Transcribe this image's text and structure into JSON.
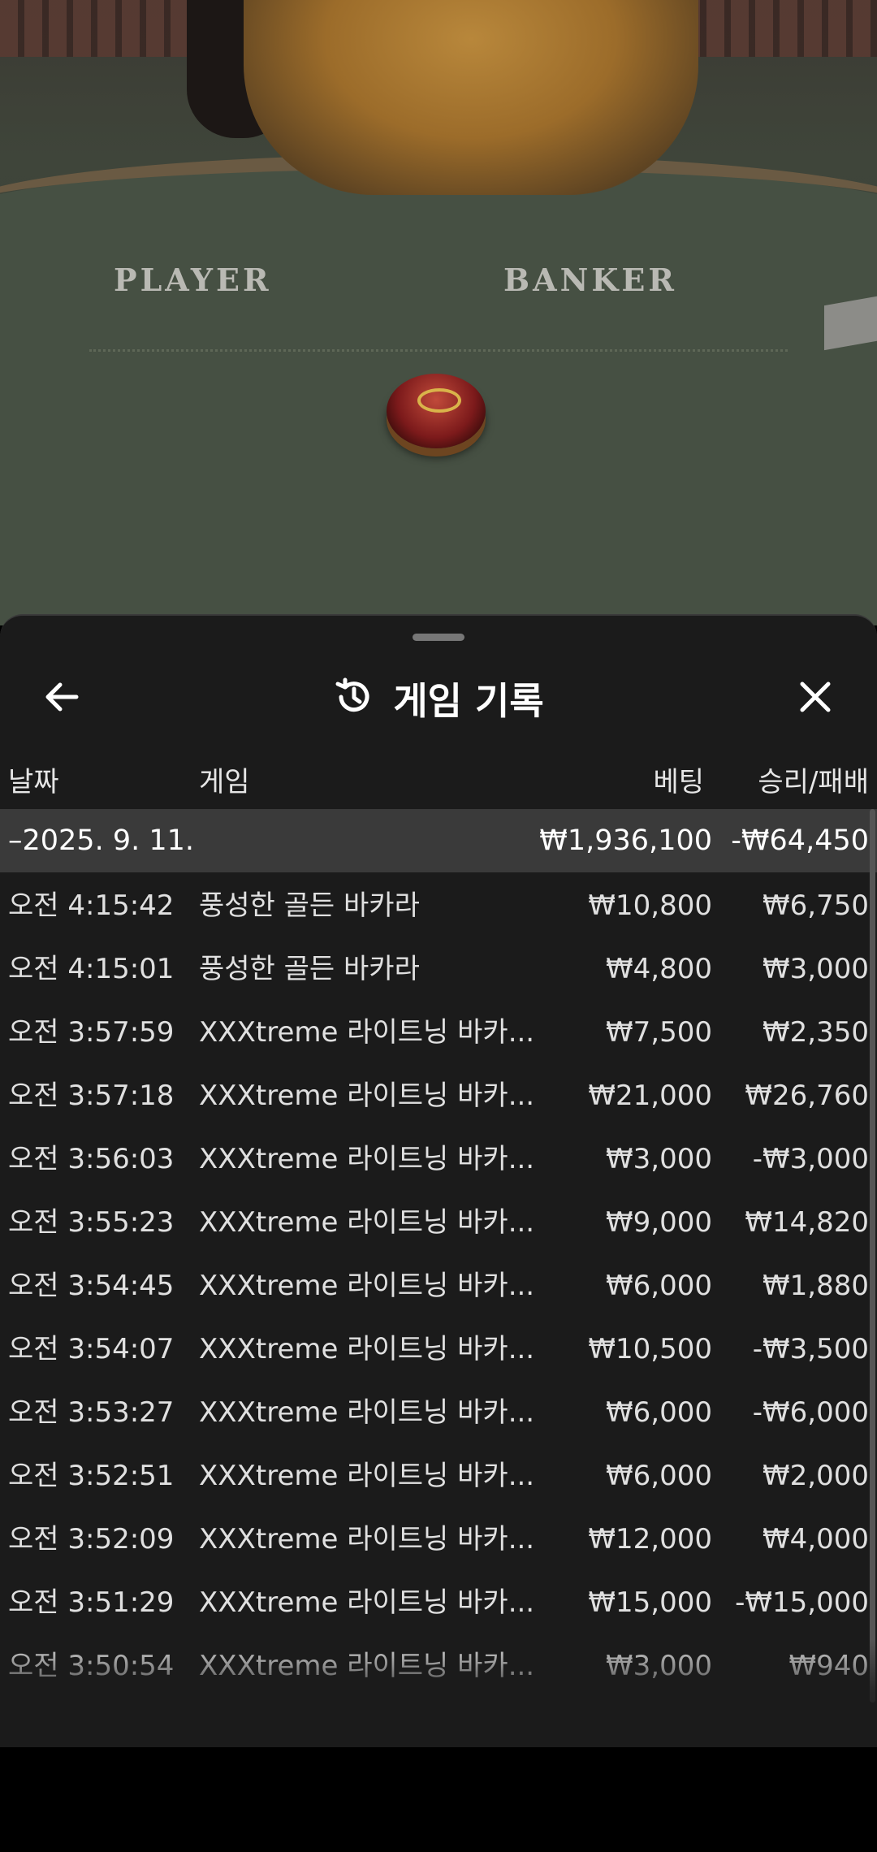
{
  "video": {
    "player_label": "PLAYER",
    "banker_label": "BANKER"
  },
  "history": {
    "title": "게임 기록",
    "icons": {
      "back": "arrow-left-icon",
      "history": "history-clock-icon",
      "close": "close-icon"
    },
    "columns": {
      "date": "날짜",
      "game": "게임",
      "bet": "베팅",
      "result": "승리/패배"
    },
    "summary": {
      "date": "–2025. 9. 11.",
      "bet": "₩1,936,100",
      "result": "-₩64,450"
    },
    "rows": [
      {
        "time": "오전 4:15:42",
        "game": "풍성한 골든 바카라",
        "bet": "₩10,800",
        "result": "₩6,750"
      },
      {
        "time": "오전 4:15:01",
        "game": "풍성한 골든 바카라",
        "bet": "₩4,800",
        "result": "₩3,000"
      },
      {
        "time": "오전 3:57:59",
        "game": "XXXtreme 라이트닝 바카...",
        "bet": "₩7,500",
        "result": "₩2,350"
      },
      {
        "time": "오전 3:57:18",
        "game": "XXXtreme 라이트닝 바카...",
        "bet": "₩21,000",
        "result": "₩26,760"
      },
      {
        "time": "오전 3:56:03",
        "game": "XXXtreme 라이트닝 바카...",
        "bet": "₩3,000",
        "result": "-₩3,000"
      },
      {
        "time": "오전 3:55:23",
        "game": "XXXtreme 라이트닝 바카...",
        "bet": "₩9,000",
        "result": "₩14,820"
      },
      {
        "time": "오전 3:54:45",
        "game": "XXXtreme 라이트닝 바카...",
        "bet": "₩6,000",
        "result": "₩1,880"
      },
      {
        "time": "오전 3:54:07",
        "game": "XXXtreme 라이트닝 바카...",
        "bet": "₩10,500",
        "result": "-₩3,500"
      },
      {
        "time": "오전 3:53:27",
        "game": "XXXtreme 라이트닝 바카...",
        "bet": "₩6,000",
        "result": "-₩6,000"
      },
      {
        "time": "오전 3:52:51",
        "game": "XXXtreme 라이트닝 바카...",
        "bet": "₩6,000",
        "result": "₩2,000"
      },
      {
        "time": "오전 3:52:09",
        "game": "XXXtreme 라이트닝 바카...",
        "bet": "₩12,000",
        "result": "₩4,000"
      },
      {
        "time": "오전 3:51:29",
        "game": "XXXtreme 라이트닝 바카...",
        "bet": "₩15,000",
        "result": "-₩15,000"
      },
      {
        "time": "오전 3:50:54",
        "game": "XXXtreme 라이트닝 바카...",
        "bet": "₩3,000",
        "result": "₩940"
      }
    ]
  }
}
